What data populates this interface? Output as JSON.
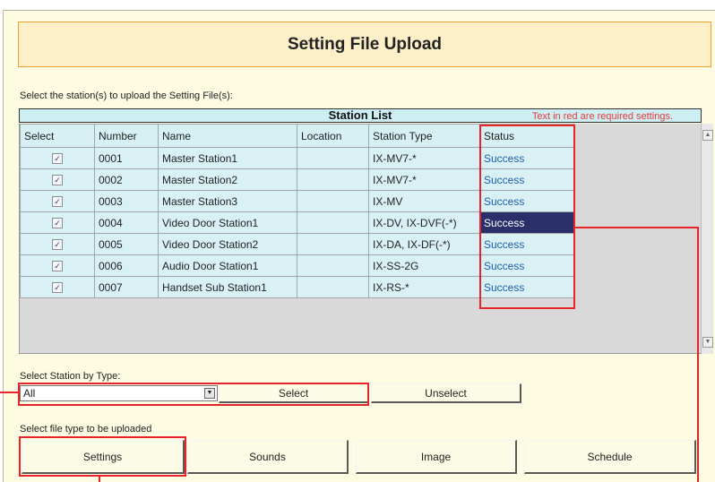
{
  "page": {
    "title": "Setting File Upload",
    "instruction": "Select the station(s) to upload the Setting File(s):"
  },
  "station_list": {
    "title": "Station List",
    "required_note": "Text in red are required settings.",
    "columns": [
      "Select",
      "Number",
      "Name",
      "Location",
      "Station Type",
      "Status"
    ],
    "rows": [
      {
        "checked": true,
        "number": "0001",
        "name": "Master Station1",
        "location": "",
        "type": "IX-MV7-*",
        "status": "Success"
      },
      {
        "checked": true,
        "number": "0002",
        "name": "Master Station2",
        "location": "",
        "type": "IX-MV7-*",
        "status": "Success"
      },
      {
        "checked": true,
        "number": "0003",
        "name": "Master Station3",
        "location": "",
        "type": "IX-MV",
        "status": "Success"
      },
      {
        "checked": true,
        "number": "0004",
        "name": "Video Door Station1",
        "location": "",
        "type": "IX-DV, IX-DVF(-*)",
        "status": "Success"
      },
      {
        "checked": true,
        "number": "0005",
        "name": "Video Door Station2",
        "location": "",
        "type": "IX-DA, IX-DF(-*)",
        "status": "Success"
      },
      {
        "checked": true,
        "number": "0006",
        "name": "Audio Door Station1",
        "location": "",
        "type": "IX-SS-2G",
        "status": "Success"
      },
      {
        "checked": true,
        "number": "0007",
        "name": "Handset Sub Station1",
        "location": "",
        "type": "IX-RS-*",
        "status": "Success"
      }
    ],
    "checkmark": "✓",
    "selected_status_row": 3
  },
  "select_by_type": {
    "label": "Select Station by Type:",
    "dropdown_value": "All",
    "select_label": "Select",
    "unselect_label": "Unselect"
  },
  "file_type": {
    "label": "Select file type to be uploaded",
    "buttons": [
      "Settings",
      "Sounds",
      "Image",
      "Schedule"
    ]
  },
  "icons": {
    "dropdown_arrow": "chevron-down-icon",
    "scroll_up": "arrow-up-icon",
    "scroll_down": "arrow-down-icon"
  },
  "colors": {
    "title_border": "#f0a030",
    "required_text": "#e8393a",
    "status_text": "#1f5fb0",
    "callout": "#e8242a",
    "selected_cell": "#2a2f6a"
  }
}
